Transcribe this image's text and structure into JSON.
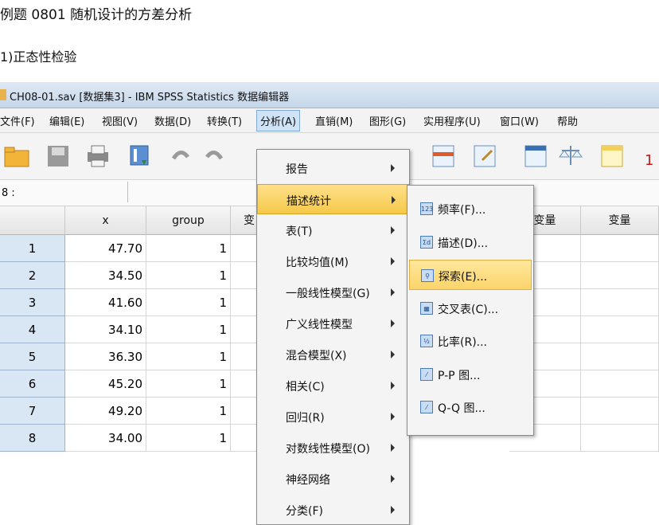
{
  "doc": {
    "title": "例题 0801 随机设计的方差分析",
    "subtitle": "1)正态性检验"
  },
  "window": {
    "title": "CH08-01.sav [数据集3] - IBM SPSS Statistics 数据编辑器"
  },
  "menubar": {
    "items": [
      "文件(F)",
      "编辑(E)",
      "视图(V)",
      "数据(D)",
      "转换(T)",
      "分析(A)",
      "直销(M)",
      "图形(G)",
      "实用程序(U)",
      "窗口(W)",
      "帮助"
    ],
    "active": "分析(A)"
  },
  "cell_ref": "8 :",
  "grid": {
    "columns": [
      "x",
      "group",
      "变",
      "变量",
      "变量"
    ],
    "rows": [
      {
        "n": "1",
        "x": "47.70",
        "group": "1"
      },
      {
        "n": "2",
        "x": "34.50",
        "group": "1"
      },
      {
        "n": "3",
        "x": "41.60",
        "group": "1"
      },
      {
        "n": "4",
        "x": "34.10",
        "group": "1"
      },
      {
        "n": "5",
        "x": "36.30",
        "group": "1"
      },
      {
        "n": "6",
        "x": "45.20",
        "group": "1"
      },
      {
        "n": "7",
        "x": "49.20",
        "group": "1"
      },
      {
        "n": "8",
        "x": "34.00",
        "group": "1"
      }
    ]
  },
  "analyze_menu": {
    "items": [
      "报告",
      "描述统计",
      "表(T)",
      "比较均值(M)",
      "一般线性模型(G)",
      "广义线性模型",
      "混合模型(X)",
      "相关(C)",
      "回归(R)",
      "对数线性模型(O)",
      "神经网络",
      "分类(F)"
    ],
    "highlighted": "描述统计"
  },
  "descriptive_submenu": {
    "items": [
      {
        "label": "频率(F)...",
        "icon": "123"
      },
      {
        "label": "描述(D)...",
        "icon": "Σd"
      },
      {
        "label": "探索(E)...",
        "icon": "⚲"
      },
      {
        "label": "交叉表(C)...",
        "icon": "▦"
      },
      {
        "label": "比率(R)...",
        "icon": "½"
      },
      {
        "label": "P-P 图...",
        "icon": "⁄"
      },
      {
        "label": "Q-Q 图...",
        "icon": "⁄"
      }
    ],
    "highlighted": "探索(E)..."
  },
  "colors": {
    "menu_highlight": "#f6c94a",
    "row_header": "#d9e6f4",
    "titlebar": "#c6d7ea"
  }
}
